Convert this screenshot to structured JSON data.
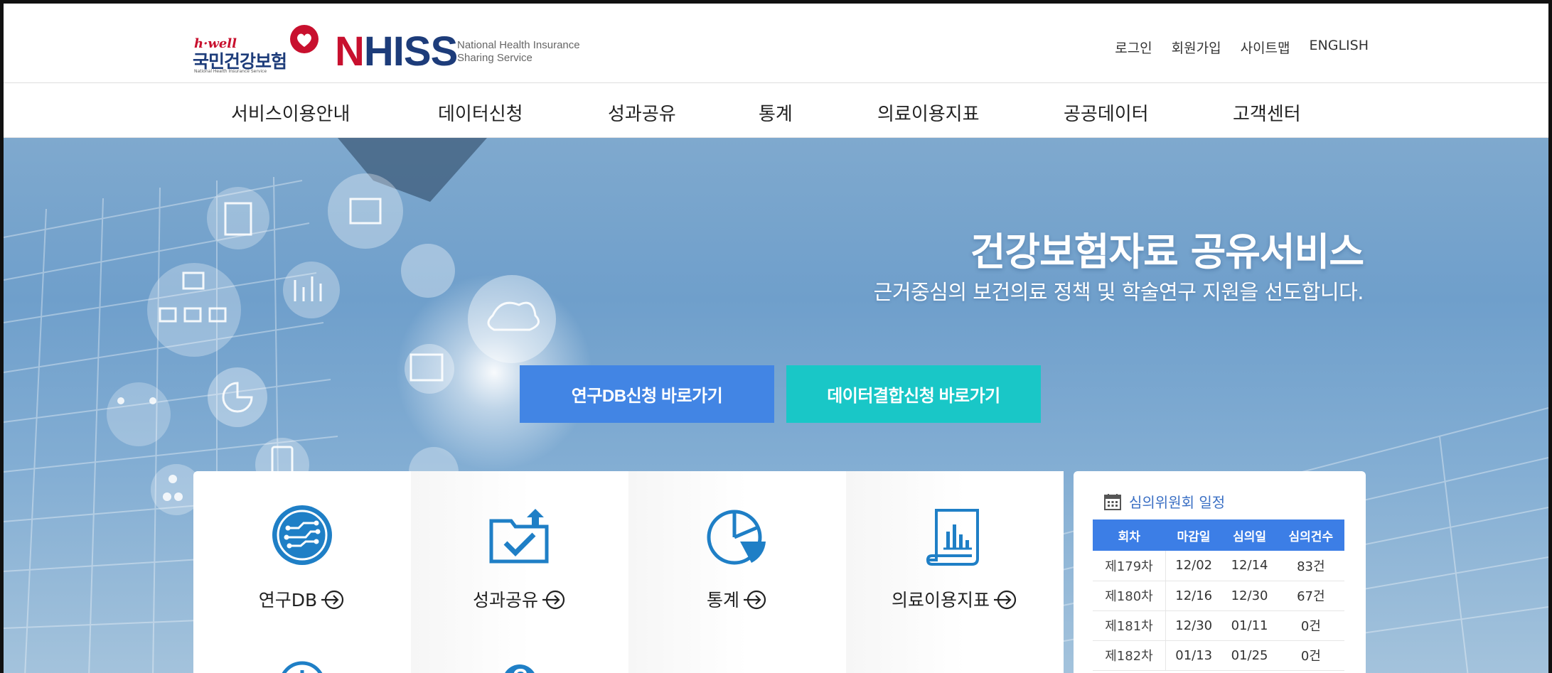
{
  "header": {
    "logo": {
      "hwell": "h·well",
      "korean": "국민건강보험",
      "tiny": "National Health Insurance Service",
      "nhiss_n": "N",
      "nhiss_rest": "HISS",
      "sub_line1": "National Health Insurance",
      "sub_line2": "Sharing Service"
    },
    "util": [
      "로그인",
      "회원가입",
      "사이트맵",
      "ENGLISH"
    ]
  },
  "gnb": [
    "서비스이용안내",
    "데이터신청",
    "성과공유",
    "통계",
    "의료이용지표",
    "공공데이터",
    "고객센터"
  ],
  "hero": {
    "title": "건강보험자료 공유서비스",
    "subtitle": "근거중심의 보건의료 정책 및 학술연구 지원을 선도합니다.",
    "btn_db": "연구DB신청 바로가기",
    "btn_join": "데이터결합신청 바로가기"
  },
  "quick": [
    {
      "label": "연구DB",
      "icon": "circuit-icon"
    },
    {
      "label": "성과공유",
      "icon": "folder-upload-icon"
    },
    {
      "label": "통계",
      "icon": "pie-chart-icon"
    },
    {
      "label": "의료이용지표",
      "icon": "bar-chart-document-icon"
    }
  ],
  "schedule": {
    "title": "심의위원회 일정",
    "headers": [
      "회차",
      "마감일",
      "심의일",
      "심의건수"
    ],
    "rows": [
      [
        "제179차",
        "12/02",
        "12/14",
        "83건"
      ],
      [
        "제180차",
        "12/16",
        "12/30",
        "67건"
      ],
      [
        "제181차",
        "12/30",
        "01/11",
        "0건"
      ],
      [
        "제182차",
        "01/13",
        "01/25",
        "0건"
      ]
    ]
  },
  "colors": {
    "brand_red": "#c8102e",
    "brand_navy": "#1d3c7a",
    "button_blue": "#4285e4",
    "button_teal": "#19c7c7",
    "icon_blue": "#1f7fc6",
    "table_header": "#3c7ee6"
  }
}
